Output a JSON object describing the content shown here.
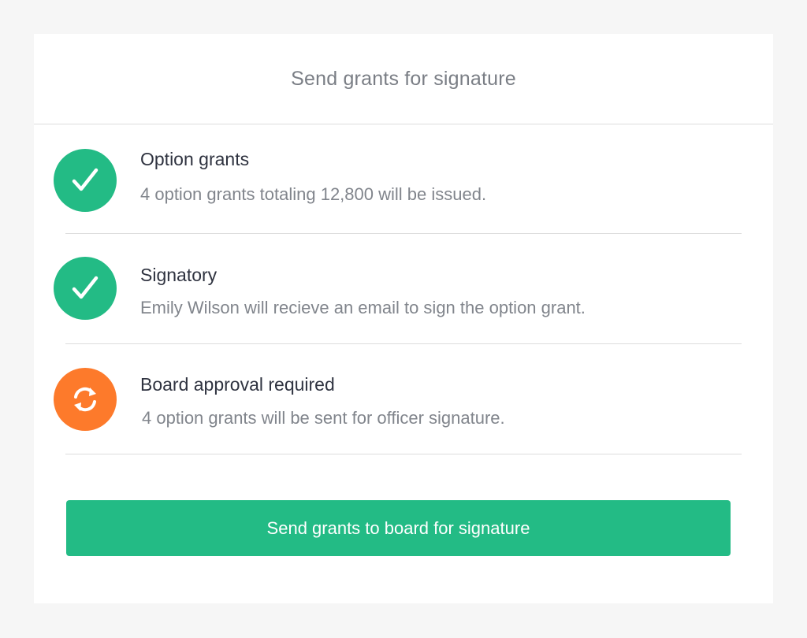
{
  "modal": {
    "title": "Send grants for signature"
  },
  "items": [
    {
      "title": "Option grants",
      "description": "4 option grants totaling 12,800 will be issued.",
      "status": "complete",
      "icon": "check-icon",
      "icon_color": "#23bb85"
    },
    {
      "title": "Signatory",
      "description": "Emily Wilson will recieve an email to sign the option grant.",
      "status": "complete",
      "icon": "check-icon",
      "icon_color": "#23bb85"
    },
    {
      "title": "Board approval required",
      "description": "4 option grants will be sent for officer signature.",
      "status": "pending",
      "icon": "refresh-icon",
      "icon_color": "#fd7a2b"
    }
  ],
  "action": {
    "send_label": "Send grants to board for signature",
    "color": "#23bb85"
  },
  "colors": {
    "success": "#23bb85",
    "warning": "#fd7a2b",
    "title_text": "#2f3340",
    "muted_text": "#81858c"
  }
}
